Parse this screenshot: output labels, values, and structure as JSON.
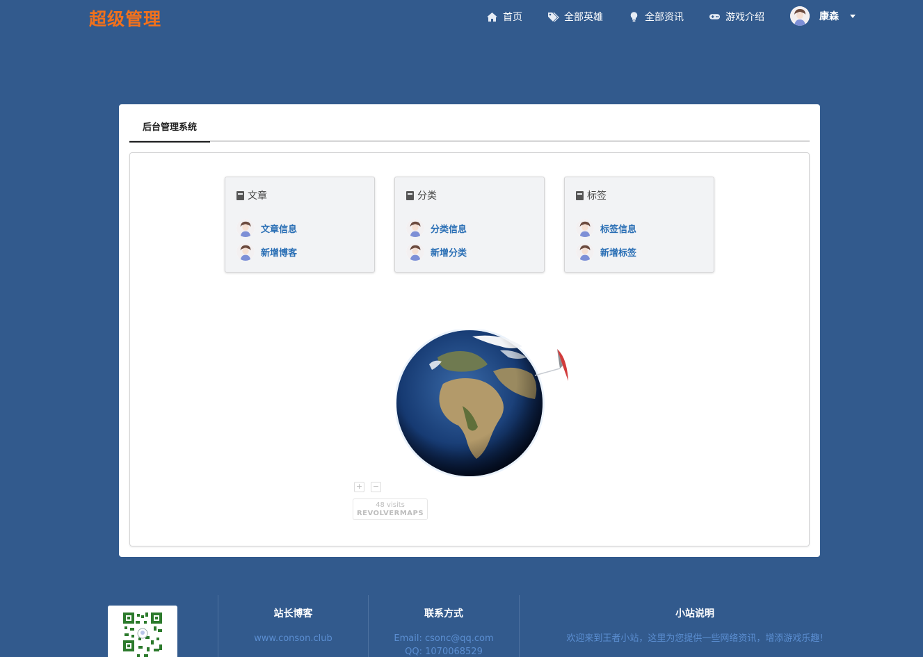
{
  "header": {
    "brand": "超级管理",
    "nav": [
      {
        "label": "首页",
        "icon": "home-icon"
      },
      {
        "label": "全部英雄",
        "icon": "tags-icon"
      },
      {
        "label": "全部资讯",
        "icon": "lightbulb-icon"
      },
      {
        "label": "游戏介绍",
        "icon": "gamepad-icon"
      }
    ],
    "user": {
      "name": "康森"
    }
  },
  "main": {
    "tab": "后台管理系统",
    "cards": [
      {
        "title": "文章",
        "links": [
          "文章信息",
          "新增博客"
        ]
      },
      {
        "title": "分类",
        "links": [
          "分类信息",
          "新增分类"
        ]
      },
      {
        "title": "标签",
        "links": [
          "标签信息",
          "新增标签"
        ]
      }
    ],
    "widget": {
      "zoom_in": "+",
      "zoom_out": "−",
      "visits": "48 visits",
      "provider": "REVOLVERMAPS"
    }
  },
  "footer": {
    "blog": {
      "title": "站长博客",
      "url": "www.conson.club"
    },
    "contact": {
      "title": "联系方式",
      "email": "Email: csonc@qq.com",
      "qq": "QQ: 1070068529"
    },
    "about": {
      "title": "小站说明",
      "text": "欢迎来到王者小站，这里为您提供一些网络资讯，增添游戏乐趣!"
    }
  },
  "colors": {
    "background": "#325a8d",
    "brand": "#f2711c",
    "link": "#2a6fb5",
    "footer_text": "#5b8ed1"
  }
}
